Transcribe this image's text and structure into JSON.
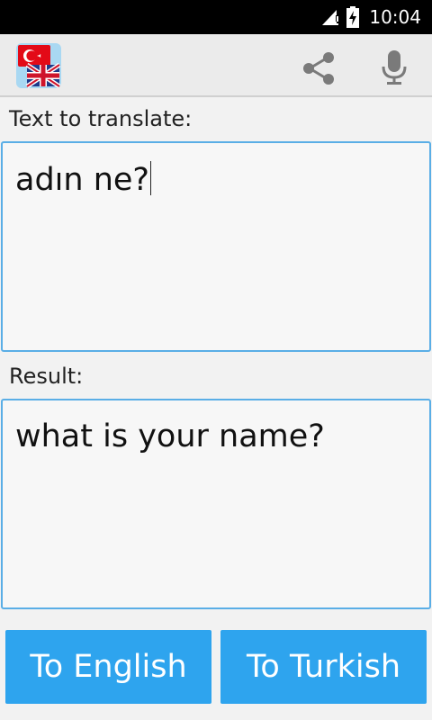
{
  "status_bar": {
    "time": "10:04",
    "icons": [
      "signal-icon",
      "battery-charging-icon"
    ]
  },
  "app_bar": {
    "logo": "turkey-uk-flag-icon",
    "actions": [
      "share-icon",
      "mic-icon"
    ]
  },
  "source": {
    "label": "Text to translate:",
    "value": "adın ne?"
  },
  "result": {
    "label": "Result:",
    "value": "what is your name?"
  },
  "buttons": {
    "to_english": "To English",
    "to_turkish": "To Turkish"
  },
  "colors": {
    "accent": "#2ea4ee",
    "box_border": "#5aaee6",
    "app_bar": "#ebebeb",
    "status_bar": "#000000"
  }
}
